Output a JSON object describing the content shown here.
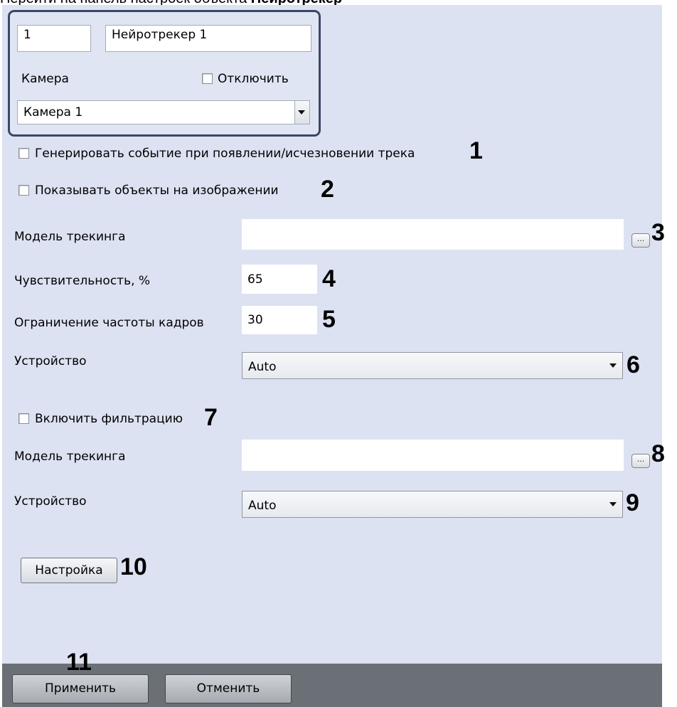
{
  "caption": {
    "prefix": "Перейти на панель настроек объекта ",
    "bold": "Нейротрекер"
  },
  "camera_block": {
    "id_value": "1",
    "name_value": "Нейротрекер 1",
    "camera_label": "Камера",
    "disable_label": "Отключить",
    "camera_select_value": "Камера 1"
  },
  "options": {
    "generate_event_label": "Генерировать событие при появлении/исчезновении трека",
    "show_objects_label": "Показывать объекты на изображении",
    "tracking_model_label": "Модель трекинга",
    "tracking_model_value": "",
    "dots": "...",
    "sensitivity_label": "Чувствительность, %",
    "sensitivity_value": "65",
    "frame_limit_label": "Ограничение частоты кадров",
    "frame_limit_value": "30",
    "device_label": "Устройство",
    "device_value": "Auto",
    "enable_filter_label": "Включить фильтрацию",
    "filter_model_label": "Модель трекинга",
    "filter_model_value": "",
    "filter_device_label": "Устройство",
    "filter_device_value": "Auto",
    "setup_button": "Настройка"
  },
  "footer": {
    "apply_button": "Применить",
    "cancel_button": "Отменить"
  },
  "markers": [
    "1",
    "2",
    "3",
    "4",
    "5",
    "6",
    "7",
    "8",
    "9",
    "10",
    "11"
  ]
}
